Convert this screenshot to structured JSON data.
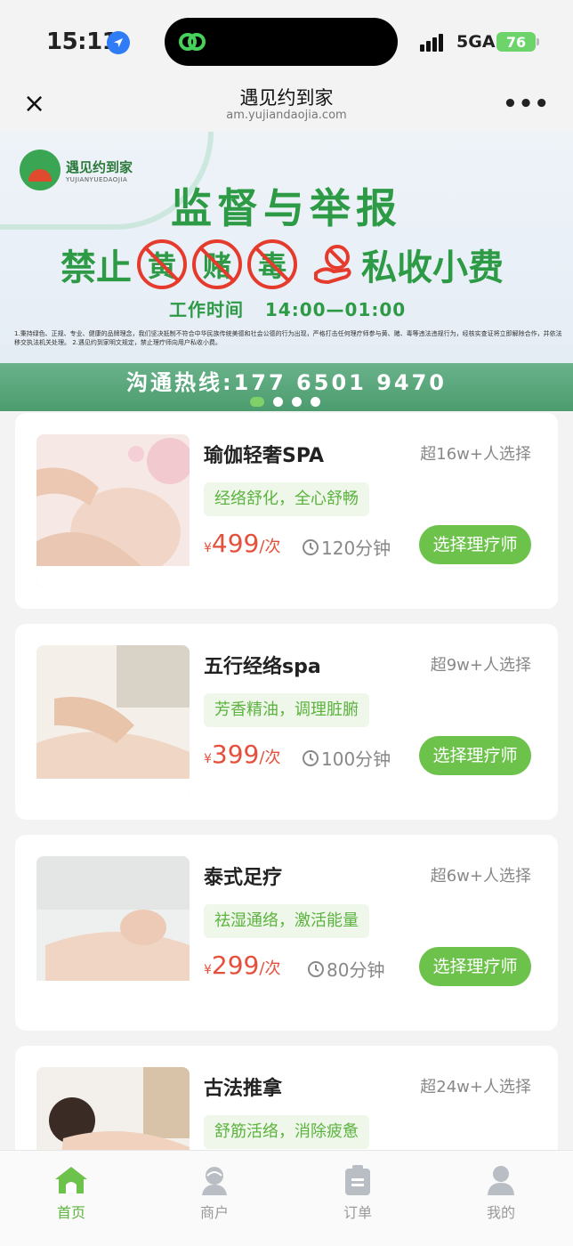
{
  "status": {
    "time": "15:11",
    "network": "5GA",
    "battery": "76"
  },
  "nav": {
    "title": "遇见约到家",
    "url": "am.yujiandaojia.com",
    "close_label": "×",
    "more_label": "•••"
  },
  "banner": {
    "logo_name": "遇见约到家",
    "logo_sub": "YUJIANYUEDAOJIA",
    "heading": "监督与举报",
    "ban_prefix": "禁止",
    "ban_items": [
      "黄",
      "赌",
      "毒"
    ],
    "ban_suffix": "私收小费",
    "work_time_label": "工作时间",
    "work_time": "14:00—01:00",
    "notes": "1.秉持绿色、正规、专业、健康的品牌理念，我们坚决抵制不符合中华民族传统美德和社会公德的行为出现，严格打击任何理疗师参与黄、赌、毒等违法违规行为，经核实查证将立即解除合作，并依法移交执法机关处理。 2.遇见约到家明文规定，禁止理疗师向用户私收小费。",
    "hotline": "沟通热线:177 6501 9470",
    "active_slide": 1,
    "slide_count": 4
  },
  "services": [
    {
      "name": "瑜伽轻奢SPA",
      "popularity": "超16w+人选择",
      "tag": "经络舒化，全心舒畅",
      "currency": "¥",
      "price": "499",
      "unit": "/次",
      "duration": "120分钟",
      "button": "选择理疗师"
    },
    {
      "name": "五行经络spa",
      "popularity": "超9w+人选择",
      "tag": "芳香精油，调理脏腑",
      "currency": "¥",
      "price": "399",
      "unit": "/次",
      "duration": "100分钟",
      "button": "选择理疗师"
    },
    {
      "name": "泰式足疗",
      "popularity": "超6w+人选择",
      "tag": "祛湿通络，激活能量",
      "currency": "¥",
      "price": "299",
      "unit": "/次",
      "duration": "80分钟",
      "button": "选择理疗师"
    },
    {
      "name": "古法推拿",
      "popularity": "超24w+人选择",
      "tag": "舒筋活络，消除疲惫",
      "currency": "¥",
      "price": "",
      "unit": "",
      "duration": "",
      "button": ""
    }
  ],
  "tabbar": [
    {
      "label": "首页",
      "icon": "home-icon",
      "active": true
    },
    {
      "label": "商户",
      "icon": "merchant-icon",
      "active": false
    },
    {
      "label": "订单",
      "icon": "order-icon",
      "active": false
    },
    {
      "label": "我的",
      "icon": "profile-icon",
      "active": false
    }
  ],
  "colors": {
    "accent": "#6cc24a",
    "price": "#e4503c",
    "banner_green": "#2d9a45"
  }
}
